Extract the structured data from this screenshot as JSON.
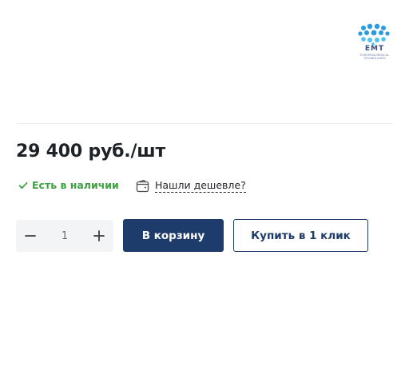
{
  "brand": {
    "logo_text": "EMT",
    "logo_subtext": "EUROPEAN MEDICAL TECHNOLOGIES",
    "logo_colors": [
      "#2a9be0",
      "#4fc3ee",
      "#3a4f86"
    ]
  },
  "product": {
    "price": "29 400 руб./шт",
    "stock_status": "Есть в наличии",
    "stock_color": "#3fa142",
    "found_cheaper": "Нашли дешевле?"
  },
  "quantity": {
    "value": "1",
    "decrement_icon": "minus-icon",
    "increment_icon": "plus-icon"
  },
  "actions": {
    "add_to_cart": "В корзину",
    "buy_one_click": "Купить в 1 клик",
    "primary_color": "#1e3c6b"
  }
}
